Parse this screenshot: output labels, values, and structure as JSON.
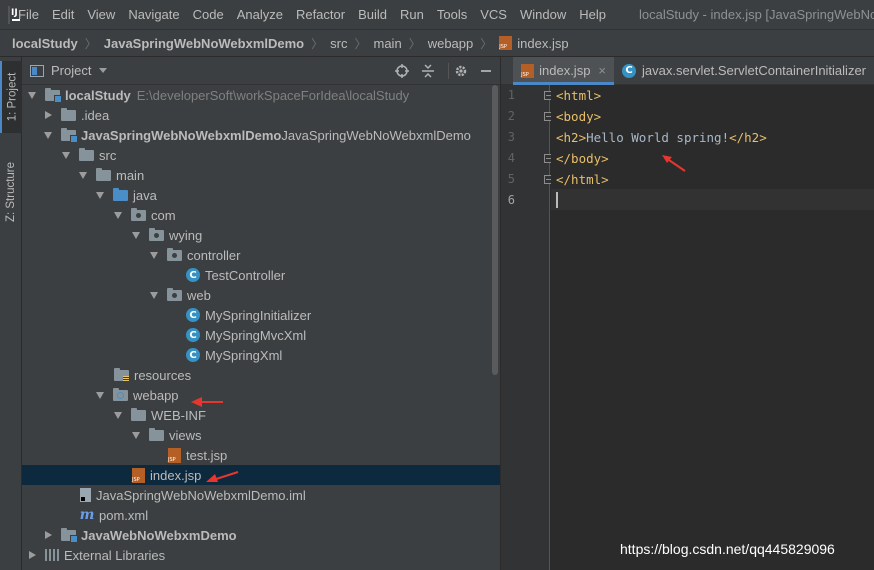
{
  "menubar": {
    "items": [
      "File",
      "Edit",
      "View",
      "Navigate",
      "Code",
      "Analyze",
      "Refactor",
      "Build",
      "Run",
      "Tools",
      "VCS",
      "Window",
      "Help"
    ],
    "window_title": "localStudy - index.jsp [JavaSpringWebNo"
  },
  "breadcrumb": [
    "localStudy",
    "JavaSpringWebNoWebxmlDemo",
    "src",
    "main",
    "webapp",
    "index.jsp"
  ],
  "tool_strip": {
    "project_tab": "1: Project",
    "structure_tab": "Z: Structure"
  },
  "project_panel": {
    "title": "Project",
    "tree": [
      {
        "label": "localStudy",
        "note": "E:\\developerSoft\\workSpaceForIdea\\localStudy"
      },
      {
        "label": ".idea"
      },
      {
        "label": "JavaSpringWebNoWebxmlDemo",
        "suffix": "JavaSpringWebNoWebxmlDemo"
      },
      {
        "label": "src"
      },
      {
        "label": "main"
      },
      {
        "label": "java"
      },
      {
        "label": "com"
      },
      {
        "label": "wying"
      },
      {
        "label": "controller"
      },
      {
        "label": "TestController"
      },
      {
        "label": "web"
      },
      {
        "label": "MySpringInitializer"
      },
      {
        "label": "MySpringMvcXml"
      },
      {
        "label": "MySpringXml"
      },
      {
        "label": "resources"
      },
      {
        "label": "webapp"
      },
      {
        "label": "WEB-INF"
      },
      {
        "label": "views"
      },
      {
        "label": "test.jsp"
      },
      {
        "label": "index.jsp"
      },
      {
        "label": "JavaSpringWebNoWebxmlDemo.iml"
      },
      {
        "label": "pom.xml"
      },
      {
        "label": "JavaWebNoWebxmDemo"
      },
      {
        "label": "External Libraries"
      }
    ],
    "class_icon_letter": "C",
    "maven_icon_letter": "m"
  },
  "editor": {
    "tabs": [
      {
        "label": "index.jsp",
        "close": "×"
      },
      {
        "label": "javax.servlet.ServletContainerInitializer"
      }
    ],
    "line_numbers": [
      "1",
      "2",
      "3",
      "4",
      "5",
      "6"
    ],
    "code": [
      {
        "open": "<html>"
      },
      {
        "open": "<body>"
      },
      {
        "open": "<h2>",
        "text": "Hello World spring!",
        "close": "</h2>"
      },
      {
        "open": "</body>"
      },
      {
        "open": "</html>"
      },
      {
        "open": ""
      }
    ]
  },
  "watermark": "https://blog.csdn.net/qq445829096",
  "colors": {
    "background": "#2b2b2b",
    "panel": "#3c3f41",
    "selection": "#0d293e",
    "tag": "#e8bf6a",
    "annotation_arrow": "#e8352d",
    "accent": "#4a88c7"
  }
}
